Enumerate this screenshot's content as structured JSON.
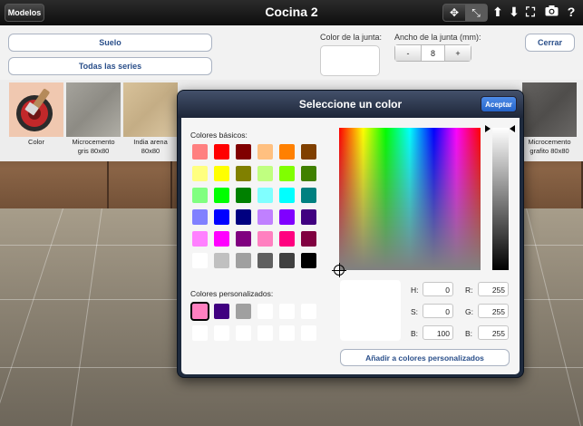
{
  "topbar": {
    "models_label": "Modelos",
    "title": "Cocina 2",
    "tools": [
      "move-icon",
      "scale-icon",
      "arrow-up-icon",
      "arrow-down-icon",
      "fit-icon",
      "camera-icon",
      "help-icon"
    ]
  },
  "controls": {
    "floor_button": "Suelo",
    "series_button": "Todas las series",
    "joint_color_label": "Color de la junta:",
    "joint_width_label": "Ancho de la junta (mm):",
    "stepper_minus": "-",
    "stepper_value": "8",
    "stepper_plus": "+",
    "close_button": "Cerrar"
  },
  "materials": [
    {
      "line1": "Color",
      "line2": ""
    },
    {
      "line1": "Microcemento",
      "line2": "gris 80x80"
    },
    {
      "line1": "India arena",
      "line2": "80x80"
    },
    {
      "line1": "Microcemento",
      "line2": "grafito 80x80"
    }
  ],
  "dialog": {
    "title": "Seleccione un color",
    "accept_label": "Aceptar",
    "basic_colors_label": "Colores básicos:",
    "basic_colors": [
      "#ff8080",
      "#ff0000",
      "#800000",
      "#ffc080",
      "#ff8000",
      "#804000",
      "#ffff80",
      "#ffff00",
      "#808000",
      "#c0ff80",
      "#80ff00",
      "#408000",
      "#80ff80",
      "#00ff00",
      "#008000",
      "#80ffff",
      "#00ffff",
      "#008080",
      "#8080ff",
      "#0000ff",
      "#000080",
      "#c080ff",
      "#8000ff",
      "#400080",
      "#ff80ff",
      "#ff00ff",
      "#800080",
      "#ff80c0",
      "#ff0080",
      "#800040",
      "#ffffff",
      "#c0c0c0",
      "#a0a0a0",
      "#606060",
      "#404040",
      "#000000"
    ],
    "custom_colors_label": "Colores personalizados:",
    "custom_colors": [
      "#ff80c0",
      "#400080",
      "#a0a0a0",
      "#ffffff",
      "#ffffff",
      "#ffffff",
      "#ffffff",
      "#ffffff",
      "#ffffff",
      "#ffffff",
      "#ffffff",
      "#ffffff"
    ],
    "hsb": {
      "h_label": "H:",
      "h": "0",
      "s_label": "S:",
      "s": "0",
      "b_label": "B:",
      "b": "100"
    },
    "rgb": {
      "r_label": "R:",
      "r": "255",
      "g_label": "G:",
      "g": "255",
      "b_label": "B:",
      "b": "255"
    },
    "add_custom_label": "Añadir a colores personalizados"
  },
  "colors": {
    "accent": "#2a4f8a",
    "accept_button": "#2463c8",
    "dialog_frame": "#1e2a3d"
  }
}
